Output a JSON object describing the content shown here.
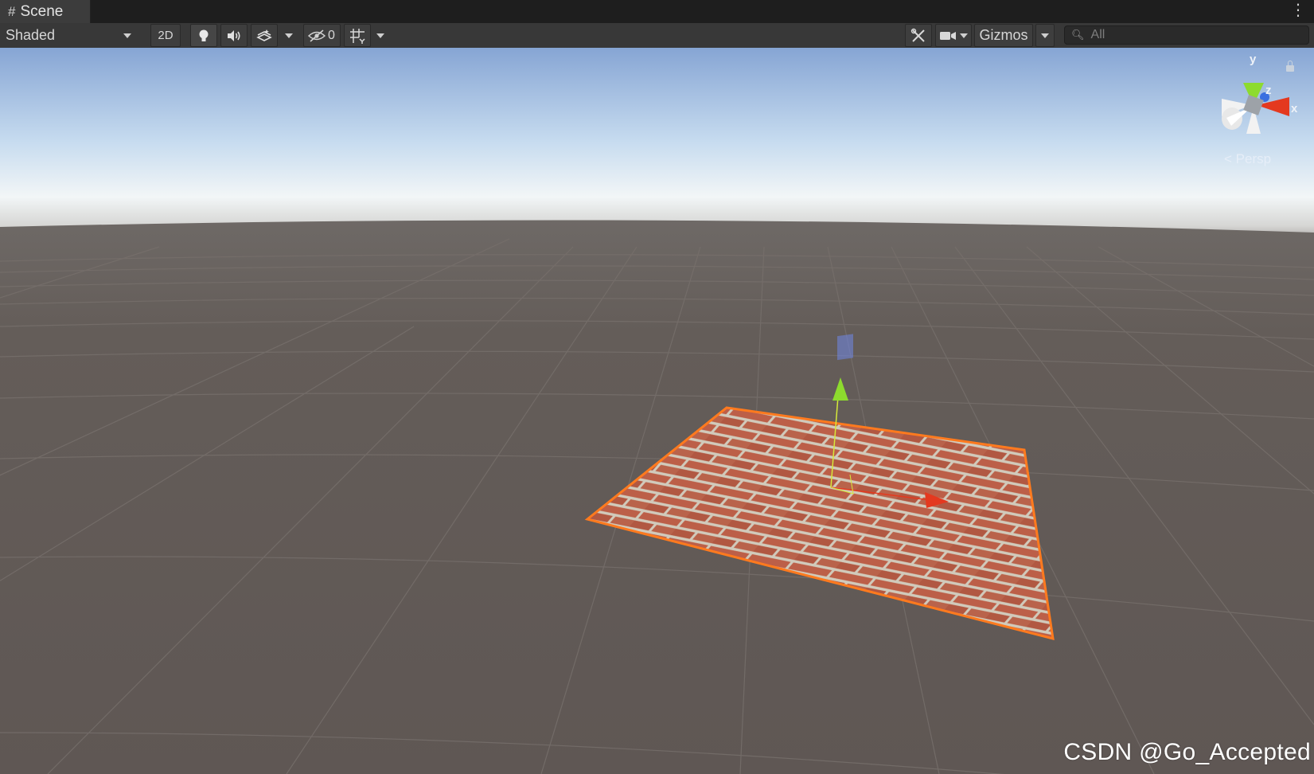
{
  "window": {
    "tab_label": "Scene",
    "tab_icon": "hash-grid-icon",
    "menu_icon": "kebab-menu-icon"
  },
  "toolbar": {
    "draw_mode": "Shaded",
    "mode_2d": "2D",
    "hidden_count": "0",
    "gizmos_label": "Gizmos",
    "search_placeholder": "All",
    "icons": [
      "lighting-icon",
      "audio-icon",
      "effects-icon",
      "visibility-icon",
      "grid-snap-icon",
      "tools-icon",
      "camera-icon"
    ]
  },
  "scene": {
    "projection_label": "Persp",
    "axis_labels": {
      "x": "x",
      "y": "y",
      "z": "z"
    },
    "selected_object": "brick-plane",
    "colors": {
      "sky_top": "#86a5d4",
      "sky_horizon": "#f2f6f7",
      "ground": "#625a56",
      "grid": "#6f6a67",
      "selection_outline": "#ff7a1e",
      "axis_x": "#e4391f",
      "axis_y": "#8ddb2e",
      "axis_z": "#3a6fe0",
      "brick": "#b8563d",
      "mortar": "#cfc7b7"
    }
  },
  "watermark": "CSDN @Go_Accepted"
}
